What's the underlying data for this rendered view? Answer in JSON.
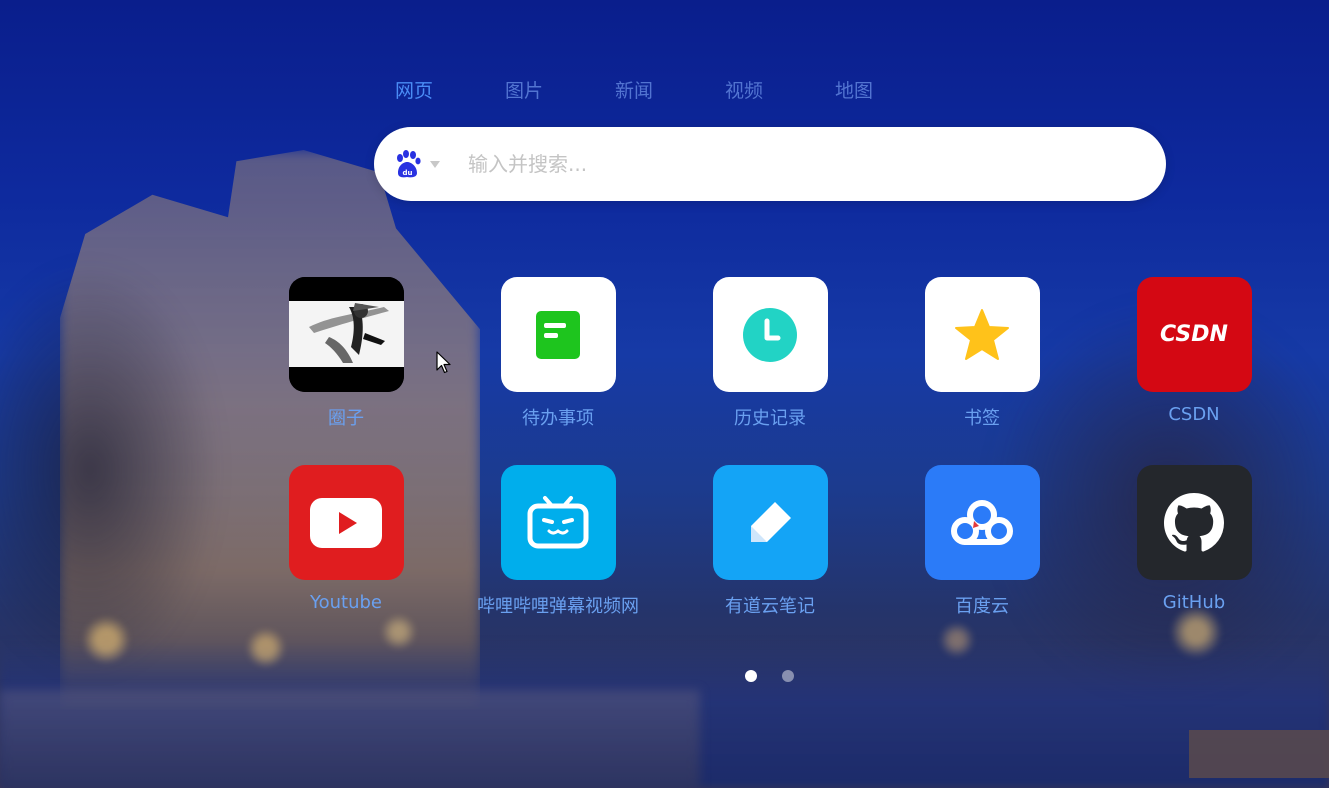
{
  "search": {
    "tabs": [
      {
        "label": "网页",
        "active": true
      },
      {
        "label": "图片",
        "active": false
      },
      {
        "label": "新闻",
        "active": false
      },
      {
        "label": "视频",
        "active": false
      },
      {
        "label": "地图",
        "active": false
      }
    ],
    "engine": "baidu",
    "engine_icon": "baidu-paw-icon",
    "placeholder": "输入并搜索...",
    "value": ""
  },
  "apps": [
    {
      "label": "圈子",
      "icon": "ink-painting-thumbnail",
      "tile_color": "#000000"
    },
    {
      "label": "待办事项",
      "icon": "todo-note-icon",
      "tile_color": "#ffffff",
      "accent": "#1ec51e"
    },
    {
      "label": "历史记录",
      "icon": "clock-icon",
      "tile_color": "#ffffff",
      "accent": "#22d3c5"
    },
    {
      "label": "书签",
      "icon": "star-icon",
      "tile_color": "#ffffff",
      "accent": "#ffc21a"
    },
    {
      "label": "CSDN",
      "icon": "csdn-logo-icon",
      "tile_color": "#d40813",
      "logo_text": "CSDN"
    },
    {
      "label": "Youtube",
      "icon": "youtube-play-icon",
      "tile_color": "#e01d1f"
    },
    {
      "label": "哔哩哔哩弹幕视频网",
      "icon": "bilibili-tv-icon",
      "tile_color": "#00aeec"
    },
    {
      "label": "有道云笔记",
      "icon": "pencil-icon",
      "tile_color": "#14a4f6"
    },
    {
      "label": "百度云",
      "icon": "baidu-cloud-icon",
      "tile_color": "#2b7bf8"
    },
    {
      "label": "GitHub",
      "icon": "github-octocat-icon",
      "tile_color": "#24272c"
    }
  ],
  "pager": {
    "pages": 2,
    "current": 1
  },
  "colors": {
    "label": "#6aa0f0",
    "active_tab": "#4a8cf5"
  }
}
